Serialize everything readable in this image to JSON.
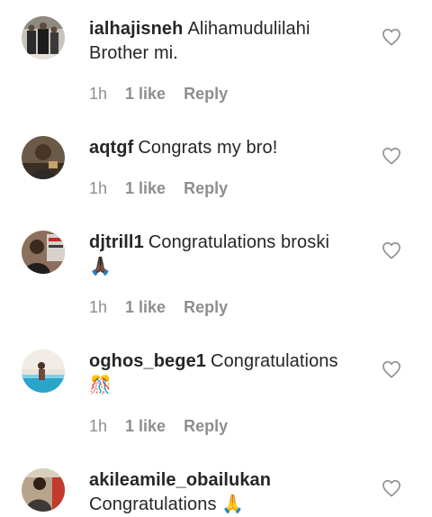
{
  "comments": [
    {
      "username": "ialhajisneh",
      "text": "Alihamudulilahi Brother mi.",
      "time": "1h",
      "likes": "1 like",
      "reply": "Reply"
    },
    {
      "username": "aqtgf",
      "text": "Congrats my bro!",
      "time": "1h",
      "likes": "1 like",
      "reply": "Reply"
    },
    {
      "username": "djtrill1",
      "text": "Congratulations broski",
      "emoji": "🙏🏿",
      "time": "1h",
      "likes": "1 like",
      "reply": "Reply"
    },
    {
      "username": "oghos_bege1",
      "text": "Congratulations",
      "emoji": "🎊",
      "time": "1h",
      "likes": "1 like",
      "reply": "Reply"
    },
    {
      "username": "akileamile_obailukan",
      "text": "Congratulations",
      "emoji": "🙏",
      "time": "",
      "likes": "",
      "reply": ""
    }
  ]
}
